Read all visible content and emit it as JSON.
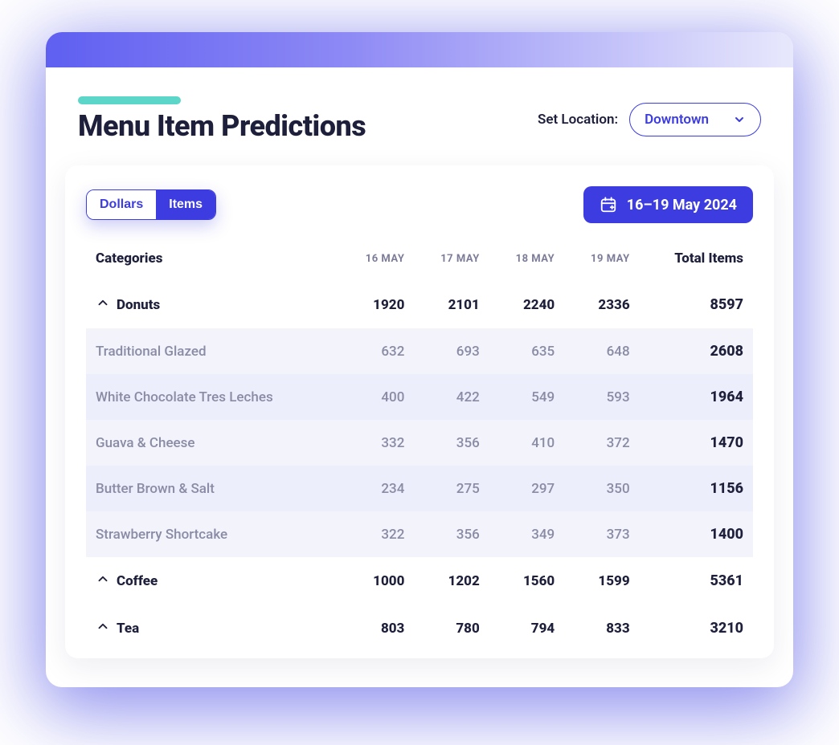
{
  "header": {
    "title": "Menu Item Predictions",
    "location_label": "Set Location:",
    "location_selected": "Downtown"
  },
  "panel": {
    "toggle": {
      "dollars": "Dollars",
      "items": "Items",
      "active": "items"
    },
    "date_range": "16–19 May 2024"
  },
  "table": {
    "header": {
      "categories": "Categories",
      "days": [
        "16 MAY",
        "17 MAY",
        "18 MAY",
        "19 MAY"
      ],
      "total": "Total Items"
    },
    "groups": [
      {
        "name": "Donuts",
        "expanded": true,
        "days": [
          1920,
          2101,
          2240,
          2336
        ],
        "total": 8597,
        "items": [
          {
            "name": "Traditional Glazed",
            "days": [
              632,
              693,
              635,
              648
            ],
            "total": 2608
          },
          {
            "name": "White Chocolate Tres Leches",
            "days": [
              400,
              422,
              549,
              593
            ],
            "total": 1964
          },
          {
            "name": "Guava & Cheese",
            "days": [
              332,
              356,
              410,
              372
            ],
            "total": 1470
          },
          {
            "name": "Butter Brown & Salt",
            "days": [
              234,
              275,
              297,
              350
            ],
            "total": 1156
          },
          {
            "name": "Strawberry Shortcake",
            "days": [
              322,
              356,
              349,
              373
            ],
            "total": 1400
          }
        ]
      },
      {
        "name": "Coffee",
        "expanded": false,
        "days": [
          1000,
          1202,
          1560,
          1599
        ],
        "total": 5361,
        "items": []
      },
      {
        "name": "Tea",
        "expanded": false,
        "days": [
          803,
          780,
          794,
          833
        ],
        "total": 3210,
        "items": []
      }
    ]
  }
}
